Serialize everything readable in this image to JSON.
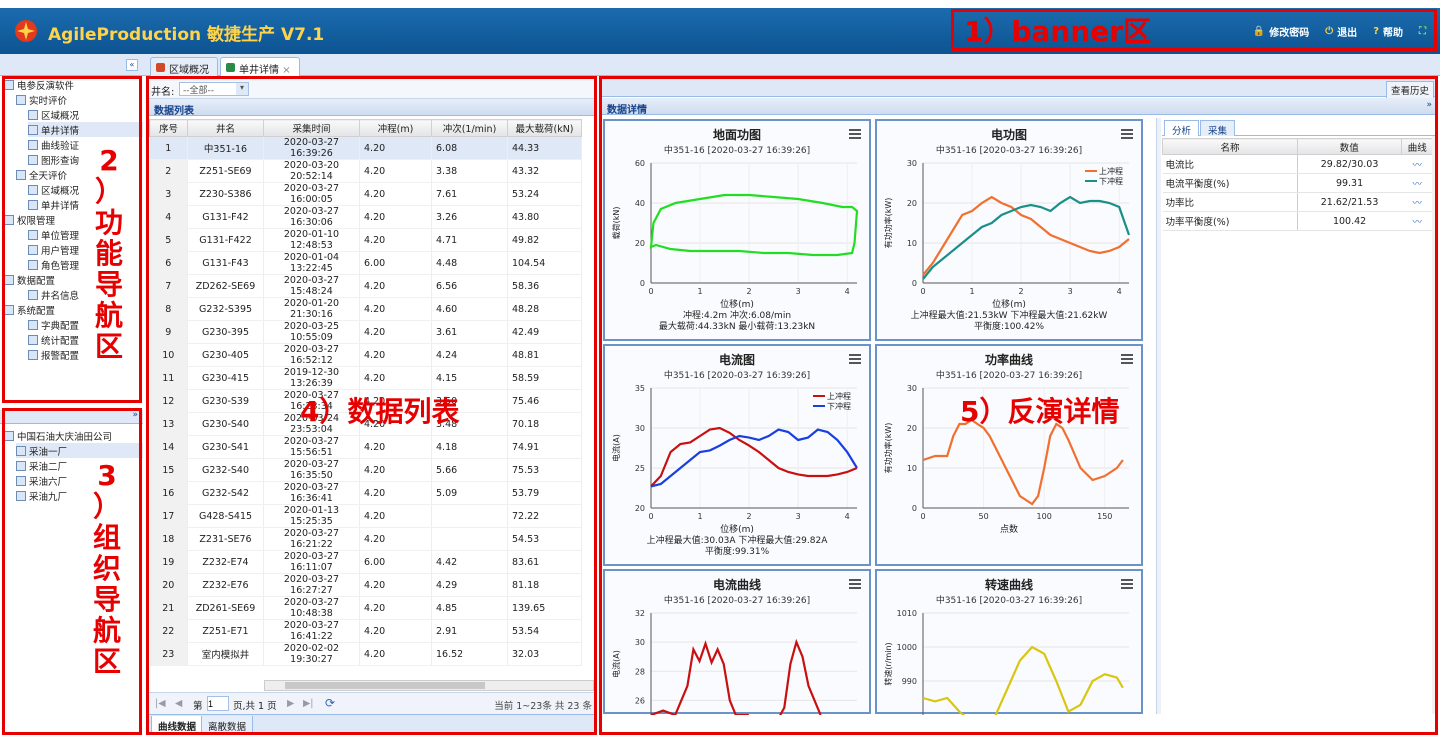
{
  "banner": {
    "title": "AgileProduction 敏捷生产 V7.1",
    "links": [
      {
        "label": "修改密码",
        "icon": "lock-icon"
      },
      {
        "label": "退出",
        "icon": "power-icon"
      },
      {
        "label": "帮助",
        "icon": "help-icon"
      }
    ],
    "fullscreen_icon": "fullscreen-icon",
    "brand_color": "#ffd34a"
  },
  "annotations": {
    "banner": "1）banner区",
    "nav": [
      "2",
      "）",
      "功",
      "能",
      "导",
      "航",
      "区"
    ],
    "org": [
      "3",
      "）",
      "组",
      "织",
      "导",
      "航",
      "区"
    ],
    "list": "4）数据列表",
    "detail": "5）反演详情",
    "color": "#e60000"
  },
  "tabs": [
    {
      "label": "区域概况",
      "active": false
    },
    {
      "label": "单井详情",
      "active": true
    }
  ],
  "nav_tree": [
    {
      "label": "电参反演软件",
      "level": 0
    },
    {
      "label": "实时评价",
      "level": 1
    },
    {
      "label": "区域概况",
      "level": 2
    },
    {
      "label": "单井详情",
      "level": 2,
      "selected": true
    },
    {
      "label": "曲线验证",
      "level": 2
    },
    {
      "label": "图形查询",
      "level": 2
    },
    {
      "label": "全天评价",
      "level": 1
    },
    {
      "label": "区域概况",
      "level": 2
    },
    {
      "label": "单井详情",
      "level": 2
    },
    {
      "label": "权限管理",
      "level": 0
    },
    {
      "label": "单位管理",
      "level": 2
    },
    {
      "label": "用户管理",
      "level": 2
    },
    {
      "label": "角色管理",
      "level": 2
    },
    {
      "label": "数据配置",
      "level": 0
    },
    {
      "label": "井名信息",
      "level": 2
    },
    {
      "label": "系统配置",
      "level": 0
    },
    {
      "label": "字典配置",
      "level": 2
    },
    {
      "label": "统计配置",
      "level": 2
    },
    {
      "label": "报警配置",
      "level": 2
    }
  ],
  "org_tree": [
    {
      "label": "中国石油大庆油田公司",
      "level": 0
    },
    {
      "label": "采油一厂",
      "level": 1,
      "selected": true
    },
    {
      "label": "采油二厂",
      "level": 1
    },
    {
      "label": "采油六厂",
      "level": 1
    },
    {
      "label": "采油九厂",
      "level": 1
    }
  ],
  "list": {
    "filter_label": "井名:",
    "filter_value": "--全部--",
    "title": "数据列表",
    "columns": [
      "序号",
      "井名",
      "采集时间",
      "冲程(m)",
      "冲次(1/min)",
      "最大载荷(kN)"
    ],
    "rows": [
      [
        "1",
        "中351-16",
        "2020-03-27 16:39:26",
        "4.20",
        "6.08",
        "44.33"
      ],
      [
        "2",
        "Z251-SE69",
        "2020-03-20 20:52:14",
        "4.20",
        "3.38",
        "43.32"
      ],
      [
        "3",
        "Z230-S386",
        "2020-03-27 16:00:05",
        "4.20",
        "7.61",
        "53.24"
      ],
      [
        "4",
        "G131-F42",
        "2020-03-27 16:30:06",
        "4.20",
        "3.26",
        "43.80"
      ],
      [
        "5",
        "G131-F422",
        "2020-01-10 12:48:53",
        "4.20",
        "4.71",
        "49.82"
      ],
      [
        "6",
        "G131-F43",
        "2020-01-04 13:22:45",
        "6.00",
        "4.48",
        "104.54"
      ],
      [
        "7",
        "ZD262-SE69",
        "2020-03-27 15:48:24",
        "4.20",
        "6.56",
        "58.36"
      ],
      [
        "8",
        "G232-S395",
        "2020-01-20 21:30:16",
        "4.20",
        "4.60",
        "48.28"
      ],
      [
        "9",
        "G230-395",
        "2020-03-25 10:55:09",
        "4.20",
        "3.61",
        "42.49"
      ],
      [
        "10",
        "G230-405",
        "2020-03-27 16:52:12",
        "4.20",
        "4.24",
        "48.81"
      ],
      [
        "11",
        "G230-415",
        "2019-12-30 13:26:39",
        "4.20",
        "4.15",
        "58.59"
      ],
      [
        "12",
        "G230-S39",
        "2020-03-27 16:23:34",
        "4.20",
        "3.50",
        "75.46"
      ],
      [
        "13",
        "G230-S40",
        "2020-03-24 23:53:04",
        "4.20",
        "3.48",
        "70.18"
      ],
      [
        "14",
        "G230-S41",
        "2020-03-27 15:56:51",
        "4.20",
        "4.18",
        "74.91"
      ],
      [
        "15",
        "G232-S40",
        "2020-03-27 16:35:50",
        "4.20",
        "5.66",
        "75.53"
      ],
      [
        "16",
        "G232-S42",
        "2020-03-27 16:36:41",
        "4.20",
        "5.09",
        "53.79"
      ],
      [
        "17",
        "G428-S415",
        "2020-01-13 15:25:35",
        "4.20",
        "",
        "72.22"
      ],
      [
        "18",
        "Z231-SE76",
        "2020-03-27 16:21:22",
        "4.20",
        "",
        "54.53"
      ],
      [
        "19",
        "Z232-E74",
        "2020-03-27 16:11:07",
        "6.00",
        "4.42",
        "83.61"
      ],
      [
        "20",
        "Z232-E76",
        "2020-03-27 16:27:27",
        "4.20",
        "4.29",
        "81.18"
      ],
      [
        "21",
        "ZD261-SE69",
        "2020-03-27 10:48:38",
        "4.20",
        "4.85",
        "139.65"
      ],
      [
        "22",
        "Z251-E71",
        "2020-03-27 16:41:22",
        "4.20",
        "2.91",
        "53.54"
      ],
      [
        "23",
        "室内模拟井",
        "2020-02-02 19:30:27",
        "4.20",
        "16.52",
        "32.03"
      ]
    ],
    "pager": {
      "page_label": "第",
      "page_value": "1",
      "total_label": "页,共 1 页",
      "summary": "当前 1~23条 共 23 条"
    },
    "bottom_tabs": [
      {
        "label": "曲线数据",
        "active": true
      },
      {
        "label": "离散数据",
        "active": false
      }
    ]
  },
  "detail": {
    "title": "数据详情",
    "history_button": "查看历史",
    "charts": [
      {
        "title": "地面功图",
        "subtitle": "中351-16 [2020-03-27 16:39:26]",
        "ylabel": "载荷(kN)",
        "xlabel": "位移(m)",
        "footer": [
          "冲程:4.2m 冲次:6.08/min",
          "最大载荷:44.33kN 最小载荷:13.23kN"
        ]
      },
      {
        "title": "电功图",
        "subtitle": "中351-16 [2020-03-27 16:39:26]",
        "ylabel": "有功功率(kW)",
        "xlabel": "位移(m)",
        "legend": [
          "上冲程",
          "下冲程"
        ],
        "footer": [
          "上冲程最大值:21.53kW 下冲程最大值:21.62kW",
          "平衡度:100.42%"
        ]
      },
      {
        "title": "电流图",
        "subtitle": "中351-16 [2020-03-27 16:39:26]",
        "ylabel": "电流(A)",
        "xlabel": "位移(m)",
        "legend": [
          "上冲程",
          "下冲程"
        ],
        "footer": [
          "上冲程最大值:30.03A 下冲程最大值:29.82A",
          "平衡度:99.31%"
        ]
      },
      {
        "title": "功率曲线",
        "subtitle": "中351-16 [2020-03-27 16:39:26]",
        "ylabel": "有功功率(kW)",
        "xlabel": "点数",
        "footer": []
      },
      {
        "title": "电流曲线",
        "subtitle": "中351-16 [2020-03-27 16:39:26]",
        "ylabel": "电流(A)",
        "xlabel": "",
        "footer": []
      },
      {
        "title": "转速曲线",
        "subtitle": "中351-16 [2020-03-27 16:39:26]",
        "ylabel": "转速(r/min)",
        "xlabel": "",
        "footer": []
      }
    ],
    "panel_tabs": [
      {
        "label": "分析",
        "active": true
      },
      {
        "label": "采集",
        "active": false
      }
    ],
    "panel_columns": [
      "名称",
      "数值",
      "曲线"
    ],
    "panel_rows": [
      [
        "电流比",
        "29.82/30.03"
      ],
      [
        "电流平衡度(%)",
        "99.31"
      ],
      [
        "功率比",
        "21.62/21.53"
      ],
      [
        "功率平衡度(%)",
        "100.42"
      ]
    ]
  },
  "chart_data": [
    {
      "type": "line",
      "title": "地面功图",
      "xlabel": "位移(m)",
      "ylabel": "载荷(kN)",
      "xlim": [
        0,
        4.2
      ],
      "ylim": [
        0,
        60
      ],
      "xticks": [
        0,
        1,
        2,
        3,
        4
      ],
      "yticks": [
        0,
        20,
        40,
        60
      ],
      "series": [
        {
          "color": "#22dd22",
          "closed": true,
          "x": [
            0,
            0.05,
            0.2,
            0.5,
            1,
            1.5,
            2,
            2.5,
            3,
            3.5,
            3.9,
            4.1,
            4.2,
            4.15,
            4.1,
            3.8,
            3.3,
            2.8,
            2.3,
            1.8,
            1.3,
            0.8,
            0.4,
            0.1,
            0
          ],
          "y": [
            18,
            30,
            37,
            40,
            42,
            44,
            44,
            43,
            42,
            40,
            38,
            38,
            36,
            20,
            15,
            14,
            14,
            15,
            15,
            16,
            16,
            16,
            17,
            19,
            18
          ]
        }
      ]
    },
    {
      "type": "line",
      "title": "电功图",
      "xlabel": "位移(m)",
      "ylabel": "有功功率(kW)",
      "xlim": [
        0,
        4.2
      ],
      "ylim": [
        0,
        30
      ],
      "xticks": [
        0,
        1,
        2,
        3,
        4
      ],
      "yticks": [
        0,
        10,
        20,
        30
      ],
      "series": [
        {
          "name": "上冲程",
          "color": "#f07030",
          "x": [
            0,
            0.2,
            0.4,
            0.6,
            0.8,
            1,
            1.2,
            1.4,
            1.6,
            1.8,
            2,
            2.2,
            2.4,
            2.6,
            2.8,
            3,
            3.2,
            3.4,
            3.6,
            3.8,
            4,
            4.2
          ],
          "y": [
            2,
            5,
            9,
            13,
            17,
            18,
            20,
            21.5,
            20,
            19,
            17,
            16,
            14,
            12,
            11,
            10,
            9,
            8,
            7.5,
            8,
            9,
            11
          ]
        },
        {
          "name": "下冲程",
          "color": "#1a8f88",
          "x": [
            0,
            0.2,
            0.4,
            0.6,
            0.8,
            1,
            1.2,
            1.4,
            1.6,
            1.8,
            2,
            2.2,
            2.4,
            2.6,
            2.8,
            3,
            3.2,
            3.4,
            3.6,
            3.8,
            4,
            4.2
          ],
          "y": [
            1,
            4,
            6,
            8,
            10,
            12,
            14,
            15,
            17,
            18,
            19,
            19.5,
            19,
            18,
            20,
            21.5,
            20,
            20.5,
            20.5,
            20,
            19,
            12
          ]
        }
      ]
    },
    {
      "type": "line",
      "title": "电流图",
      "xlabel": "位移(m)",
      "ylabel": "电流(A)",
      "xlim": [
        0,
        4.2
      ],
      "ylim": [
        20,
        35
      ],
      "xticks": [
        0,
        1,
        2,
        3,
        4
      ],
      "yticks": [
        20,
        25,
        30,
        35
      ],
      "series": [
        {
          "name": "上冲程",
          "color": "#c81010",
          "x": [
            0,
            0.2,
            0.4,
            0.6,
            0.8,
            1,
            1.2,
            1.4,
            1.6,
            1.8,
            2,
            2.2,
            2.4,
            2.6,
            2.8,
            3,
            3.2,
            3.4,
            3.6,
            3.8,
            4,
            4.2
          ],
          "y": [
            22.7,
            24,
            27,
            28,
            28.2,
            29,
            29.8,
            30,
            29.4,
            28.5,
            27.8,
            27,
            26,
            25,
            24.5,
            24.2,
            24,
            24,
            24,
            24.2,
            24.5,
            25
          ]
        },
        {
          "name": "下冲程",
          "color": "#1a3fe0",
          "x": [
            0,
            0.2,
            0.4,
            0.6,
            0.8,
            1,
            1.2,
            1.4,
            1.6,
            1.8,
            2,
            2.2,
            2.4,
            2.6,
            2.8,
            3,
            3.2,
            3.4,
            3.6,
            3.8,
            4,
            4.2
          ],
          "y": [
            22.7,
            23,
            24,
            25,
            26,
            27,
            27.2,
            27.8,
            28.5,
            29,
            28.8,
            28.5,
            29,
            29.8,
            29.5,
            28.5,
            28.8,
            29.8,
            29.5,
            28.5,
            27,
            25
          ]
        }
      ]
    },
    {
      "type": "line",
      "title": "功率曲线",
      "xlabel": "点数",
      "ylabel": "有功功率(kW)",
      "xlim": [
        0,
        170
      ],
      "ylim": [
        0,
        30
      ],
      "xticks": [
        0,
        50,
        100,
        150
      ],
      "yticks": [
        0,
        10,
        20,
        30
      ],
      "series": [
        {
          "color": "#f07030",
          "x": [
            0,
            10,
            20,
            25,
            30,
            35,
            40,
            45,
            50,
            55,
            60,
            70,
            80,
            90,
            95,
            100,
            105,
            110,
            115,
            120,
            130,
            140,
            150,
            160,
            165
          ],
          "y": [
            12,
            13,
            13,
            18,
            21,
            21,
            22,
            21,
            20,
            18,
            15,
            9,
            3,
            1,
            3,
            10,
            18,
            21,
            20,
            17,
            10,
            7,
            8,
            10,
            12
          ]
        }
      ]
    },
    {
      "type": "line",
      "title": "电流曲线",
      "ylabel": "电流(A)",
      "xlim": [
        0,
        170
      ],
      "ylim": [
        25,
        32
      ],
      "yticks": [
        26,
        28,
        30,
        32
      ],
      "series": [
        {
          "color": "#c81010",
          "x": [
            0,
            10,
            20,
            30,
            35,
            40,
            45,
            50,
            55,
            60,
            65,
            70,
            80,
            90,
            100,
            110,
            115,
            120,
            125,
            130,
            140
          ],
          "y": [
            25,
            25.3,
            25,
            27,
            29.5,
            28.7,
            29.9,
            28.6,
            29.5,
            28.5,
            26,
            25,
            25,
            24,
            24,
            25.5,
            28.5,
            30,
            29,
            27,
            25
          ]
        }
      ]
    },
    {
      "type": "line",
      "title": "转速曲线",
      "ylabel": "转速(r/min)",
      "xlim": [
        0,
        170
      ],
      "ylim": [
        980,
        1010
      ],
      "yticks": [
        990,
        1000,
        1010
      ],
      "series": [
        {
          "color": "#d8c610",
          "x": [
            0,
            10,
            20,
            30,
            40,
            50,
            60,
            70,
            80,
            90,
            100,
            110,
            120,
            130,
            140,
            150,
            160,
            165
          ],
          "y": [
            985,
            984,
            985,
            981,
            978,
            975,
            980,
            988,
            996,
            1000,
            998,
            990,
            981,
            983,
            990,
            992,
            991,
            988
          ]
        }
      ]
    }
  ]
}
